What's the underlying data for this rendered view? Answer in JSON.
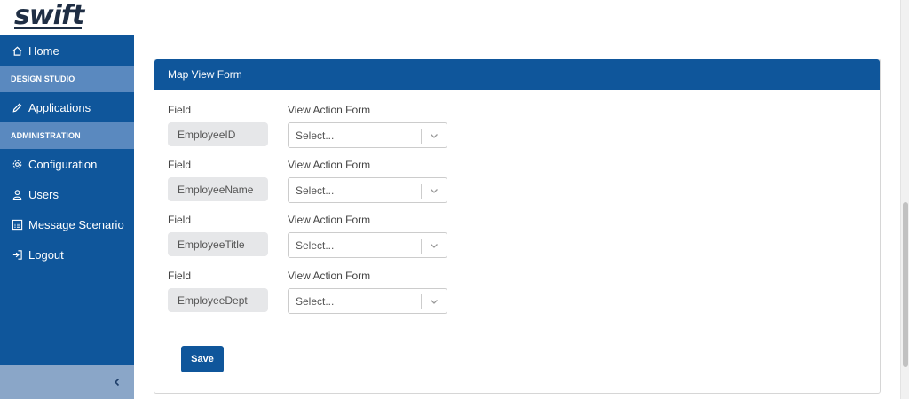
{
  "brand": {
    "logo_text": "swift"
  },
  "sidebar": {
    "home_label": "Home",
    "sections": [
      {
        "header": "DESIGN STUDIO",
        "items": [
          {
            "label": "Applications",
            "icon": "pencil-icon"
          }
        ]
      },
      {
        "header": "ADMINISTRATION",
        "items": [
          {
            "label": "Configuration",
            "icon": "gear-icon"
          },
          {
            "label": "Users",
            "icon": "user-icon"
          },
          {
            "label": "Message Scenario",
            "icon": "list-icon"
          },
          {
            "label": "Logout",
            "icon": "logout-icon"
          }
        ]
      }
    ],
    "collapse_icon": "chevron-left-icon"
  },
  "panel": {
    "title": "Map View Form",
    "field_label": "Field",
    "action_label": "View Action Form",
    "rows": [
      {
        "field": "EmployeeID",
        "placeholder": "Select..."
      },
      {
        "field": "EmployeeName",
        "placeholder": "Select..."
      },
      {
        "field": "EmployeeTitle",
        "placeholder": "Select..."
      },
      {
        "field": "EmployeeDept",
        "placeholder": "Select..."
      }
    ],
    "save_label": "Save"
  },
  "colors": {
    "primary": "#0f569b",
    "section": "#5a89bf",
    "collapse": "#8aa6c8"
  }
}
